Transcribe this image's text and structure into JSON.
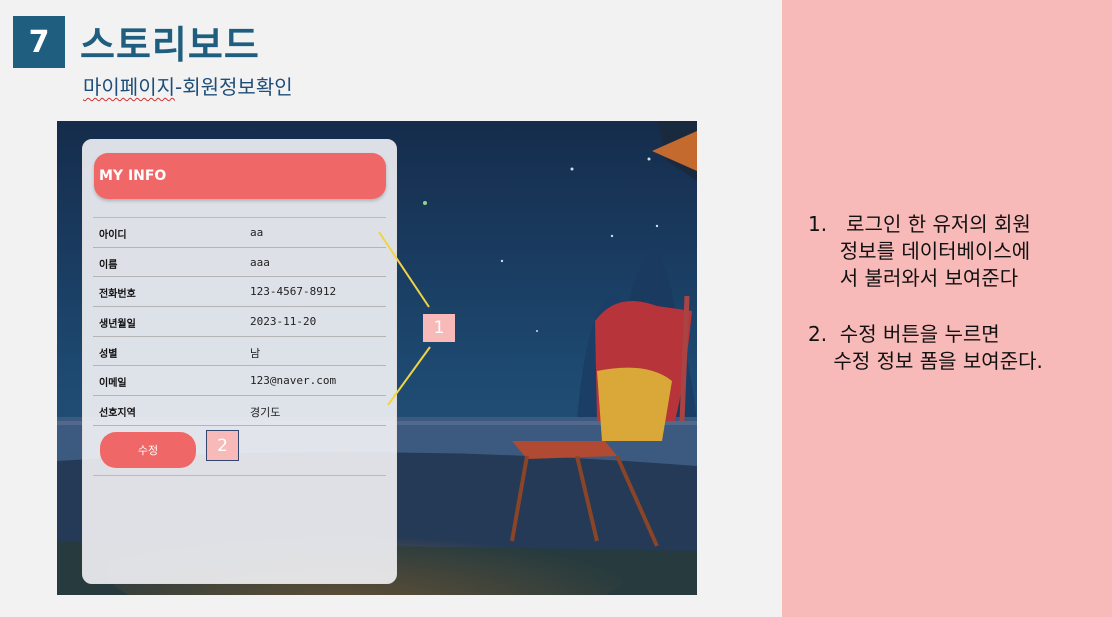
{
  "slide": {
    "number": "7",
    "title": "스토리보드",
    "subtitle_part1": "마이페이지",
    "subtitle_part2": "-회원정보확인"
  },
  "screen": {
    "header": "MY INFO",
    "rows": [
      {
        "label": "아이디",
        "value": "aa"
      },
      {
        "label": "이름",
        "value": "aaa"
      },
      {
        "label": "전화번호",
        "value": "123-4567-8912"
      },
      {
        "label": "생년월일",
        "value": "2023-11-20"
      },
      {
        "label": "성별",
        "value": "남"
      },
      {
        "label": "이메일",
        "value": "123@naver.com"
      },
      {
        "label": "선호지역",
        "value": "경기도"
      }
    ],
    "edit_button": "수정"
  },
  "callouts": {
    "one": "1",
    "two": "2"
  },
  "notes": {
    "item1": "1.   로그인 한 유저의 회원\n     정보를 데이터베이스에\n     서 불러와서 보여준다",
    "item2": "2.  수정 버튼을 누르면\n    수정 정보 폼을 보여준다."
  },
  "colors": {
    "accent": "#1f5e7e",
    "header_red": "#ef6766",
    "panel_pink": "#f8b9b9",
    "leader_yellow": "#f2d443"
  }
}
